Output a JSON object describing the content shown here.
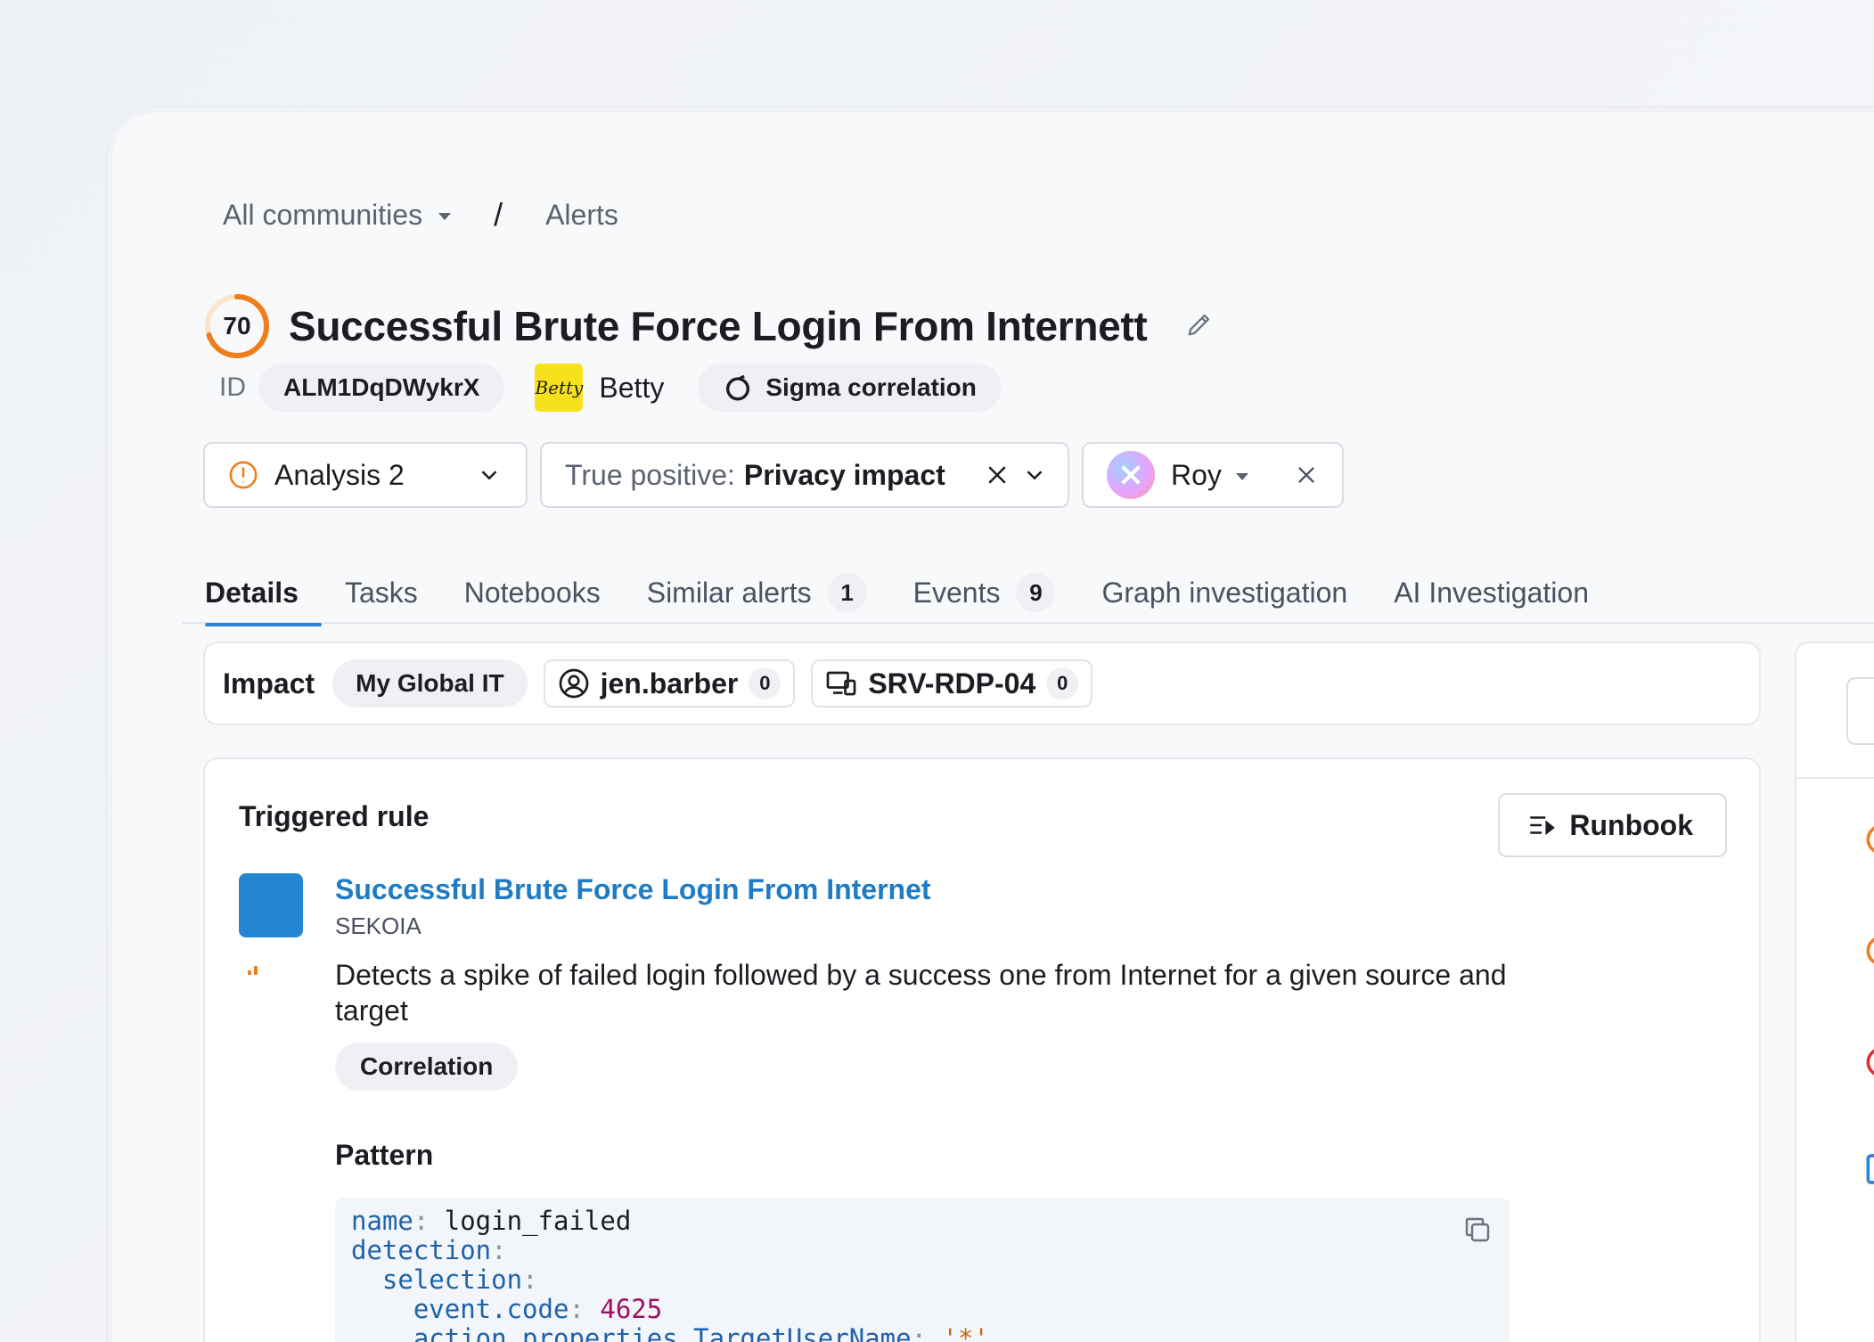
{
  "breadcrumb": {
    "community": "All communities",
    "separator": "/",
    "current": "Alerts"
  },
  "alert": {
    "score": "70",
    "score_fraction": 0.7,
    "title": "Successful Brute Force Login From Internett",
    "id_label": "ID",
    "id": "ALM1DqDWykrX",
    "owner_logo_text": "Betty",
    "owner": "Betty",
    "source": "Sigma correlation"
  },
  "filters": {
    "status": "Analysis 2",
    "verdict_prefix": "True positive:",
    "verdict_value": "Privacy impact",
    "assignee": "Roy"
  },
  "tabs": [
    {
      "label": "Details",
      "count": ""
    },
    {
      "label": "Tasks",
      "count": ""
    },
    {
      "label": "Notebooks",
      "count": ""
    },
    {
      "label": "Similar alerts",
      "count": "1"
    },
    {
      "label": "Events",
      "count": "9"
    },
    {
      "label": "Graph investigation",
      "count": ""
    },
    {
      "label": "AI Investigation",
      "count": ""
    }
  ],
  "impact": {
    "label": "Impact",
    "entity": "My Global IT",
    "user": "jen.barber",
    "user_count": "0",
    "host": "SRV-RDP-04",
    "host_count": "0"
  },
  "rule": {
    "heading": "Triggered rule",
    "runbook_label": "Runbook",
    "name": "Successful Brute Force Login From Internet",
    "vendor": "SEKOIA",
    "description": "Detects a spike of failed login followed by a success one from Internet for a given source and target",
    "tag": "Correlation",
    "pattern_label": "Pattern",
    "pattern": {
      "name_key": "name",
      "name_value": "login_failed",
      "detection_key": "detection",
      "selection_key": "selection",
      "event_code_key": "event.code",
      "event_code_value": "4625",
      "target_key": "action.properties.TargetUserName",
      "target_value": "'*'"
    }
  },
  "colors": {
    "accent_blue": "#2b86d6",
    "score_orange": "#ef7d1a",
    "rule_blue": "#2386d3",
    "betty_yellow": "#f6e11b"
  }
}
